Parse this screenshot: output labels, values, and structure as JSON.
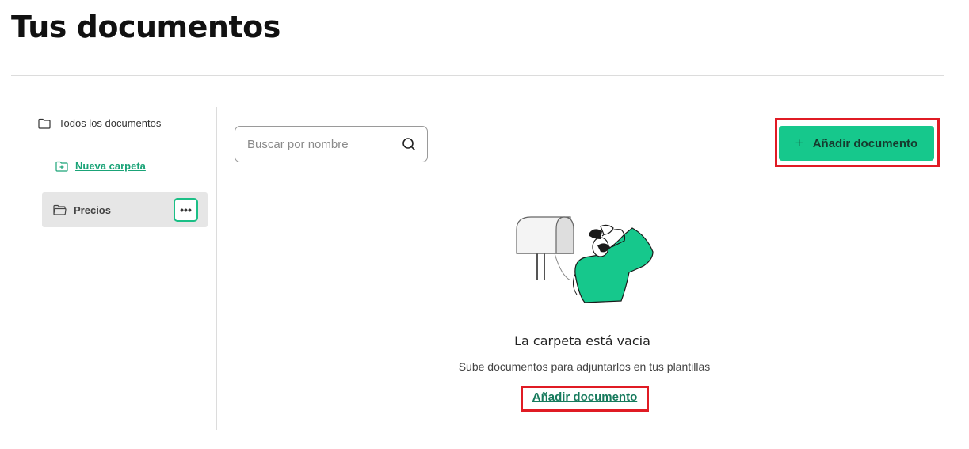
{
  "page": {
    "title": "Tus documentos"
  },
  "sidebar": {
    "all_documents_label": "Todos los documentos",
    "new_folder_label": "Nueva carpeta",
    "folders": [
      {
        "label": "Precios",
        "more_label": "•••"
      }
    ]
  },
  "search": {
    "placeholder": "Buscar por nombre",
    "value": ""
  },
  "toolbar": {
    "add_plus": "+",
    "add_label": "Añadir documento"
  },
  "empty_state": {
    "title": "La carpeta está vacia",
    "subtitle": "Sube documentos para adjuntarlos en tus plantillas",
    "link_label": "Añadir documento"
  },
  "colors": {
    "accent": "#16c88c",
    "link": "#167a5c",
    "highlight": "#e01b24",
    "folder_selected_bg": "#e6e6e6"
  }
}
